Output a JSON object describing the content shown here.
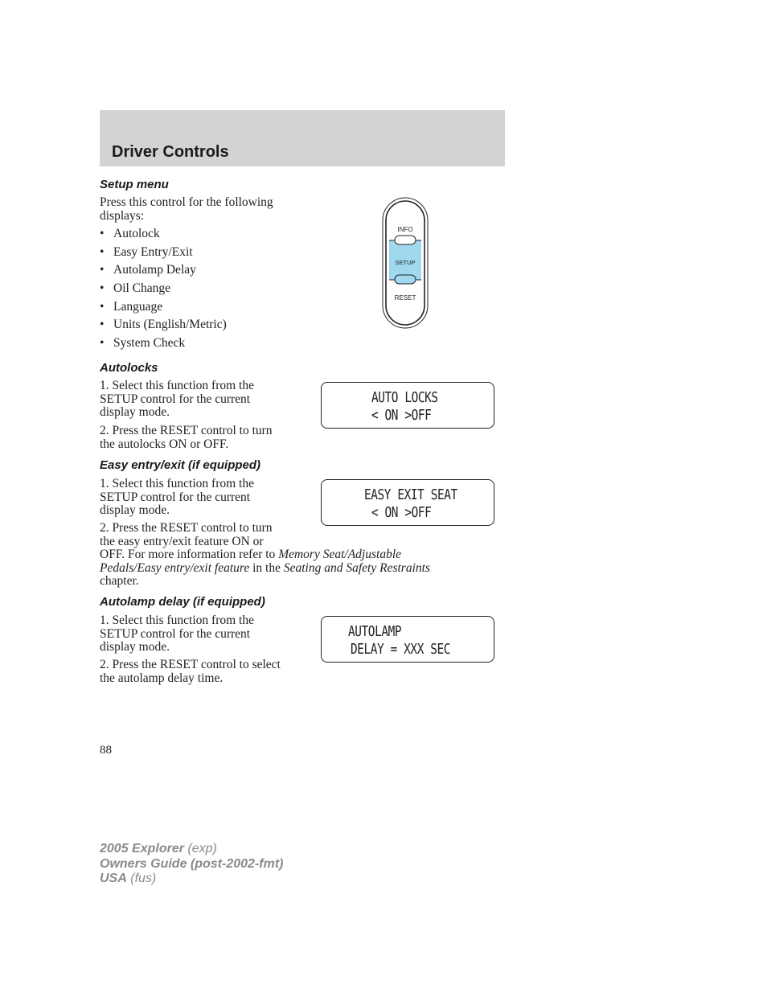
{
  "header": {
    "title": "Driver Controls"
  },
  "setup_menu": {
    "heading": "Setup menu",
    "intro_line1": "Press this control for the following",
    "intro_line2": "displays:",
    "items": [
      "Autolock",
      "Easy Entry/Exit",
      "Autolamp Delay",
      "Oil Change",
      "Language",
      "Units (English/Metric)",
      "System Check"
    ],
    "control_buttons": {
      "top": "INFO",
      "middle": "SETUP",
      "bottom": "RESET"
    },
    "highlight_color": "#9fd8ef"
  },
  "autolocks": {
    "heading": "Autolocks",
    "step1": [
      "1. Select this function from the",
      "SETUP control for the current",
      "display mode."
    ],
    "step2": [
      "2. Press the RESET control to turn",
      "the autolocks ON or OFF."
    ],
    "display": {
      "line1": "AUTO LOCKS",
      "line2": "< ON >OFF"
    }
  },
  "easy_entry": {
    "heading": "Easy entry/exit (if equipped)",
    "step1": [
      "1. Select this function from the",
      "SETUP control for the current",
      "display mode."
    ],
    "step2_lines": [
      "2. Press the RESET control to turn",
      "the easy entry/exit feature ON or"
    ],
    "step2_cont_prefix": "OFF. For more information refer to ",
    "step2_ref1_a": "Memory Seat/Adjustable",
    "step2_ref1_b": "Pedals/Easy entry/exit feature",
    "step2_mid": " in the ",
    "step2_ref2": "Seating and Safety Restraints",
    "step2_end": "chapter.",
    "display": {
      "line1": "EASY EXIT SEAT",
      "line2": "< ON >OFF"
    }
  },
  "autolamp": {
    "heading": "Autolamp delay (if equipped)",
    "step1": [
      "1. Select this function from the",
      "SETUP control for the current",
      "display mode."
    ],
    "step2": [
      "2. Press the RESET control to select",
      "the autolamp delay time."
    ],
    "display": {
      "line1": "AUTOLAMP",
      "line2": "DELAY = XXX SEC"
    }
  },
  "page_number": "88",
  "footer": {
    "line1_bold": "2005 Explorer",
    "line1_code": "(exp)",
    "line2_bold": "Owners Guide (post-2002-fmt)",
    "line3_bold": "USA",
    "line3_code": "(fus)"
  }
}
